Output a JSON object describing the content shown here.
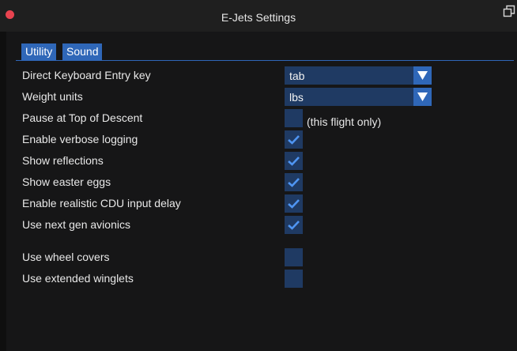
{
  "window": {
    "title": "E-Jets Settings"
  },
  "tabs": [
    {
      "label": "Utility",
      "active": true
    },
    {
      "label": "Sound",
      "active": false
    }
  ],
  "settings": {
    "keyboard_entry": {
      "label": "Direct Keyboard Entry key",
      "value": "tab"
    },
    "weight_units": {
      "label": "Weight units",
      "value": "lbs"
    },
    "pause_tod": {
      "label": "Pause at Top of Descent",
      "checked": false,
      "note": "(this flight only)"
    },
    "verbose_logging": {
      "label": "Enable verbose logging",
      "checked": true
    },
    "reflections": {
      "label": "Show reflections",
      "checked": true
    },
    "easter_eggs": {
      "label": "Show easter eggs",
      "checked": true
    },
    "cdu_delay": {
      "label": "Enable realistic CDU input delay",
      "checked": true
    },
    "next_gen_avionics": {
      "label": "Use next gen avionics",
      "checked": true
    },
    "wheel_covers": {
      "label": "Use wheel covers",
      "checked": false
    },
    "extended_winglets": {
      "label": "Use extended winglets",
      "checked": false
    }
  },
  "colors": {
    "accent": "#2f67b8",
    "control_bg": "#1f3a63",
    "background": "#161617",
    "close_button": "#e8434f"
  }
}
